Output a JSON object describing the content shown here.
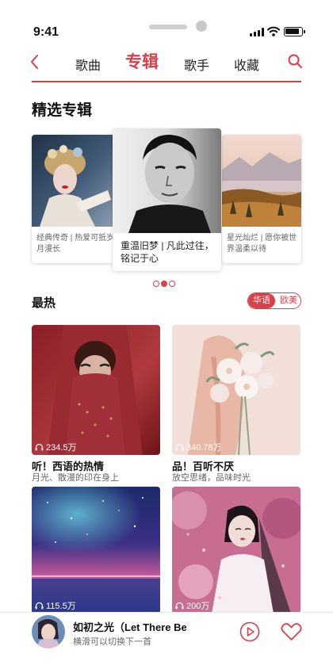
{
  "status": {
    "time": "9:41"
  },
  "nav": {
    "tabs": [
      "歌曲",
      "专辑",
      "歌手",
      "收藏"
    ],
    "active_tab": "专辑"
  },
  "featured": {
    "title": "精选专辑",
    "albums": [
      {
        "caption": "经典传奇 | 热爱可抵岁月漫长"
      },
      {
        "caption": "重温旧梦 | 凡此过往，铭记于心"
      },
      {
        "caption": "星光灿烂 | 愿你被世界温柔以待"
      }
    ],
    "page_count": 3,
    "active_page": 2
  },
  "hot": {
    "title": "最热",
    "languages": [
      "华语",
      "欧美"
    ],
    "active_language": "华语",
    "items": [
      {
        "plays": "234.5万",
        "title": "听！西语的热情",
        "subtitle": "月光、散漫的印在身上"
      },
      {
        "plays": "340.78万",
        "title": "品！百听不厌",
        "subtitle": "放空思绪，品味时光"
      },
      {
        "plays": "115.5万",
        "title": "",
        "subtitle": ""
      },
      {
        "plays": "200万",
        "title": "",
        "subtitle": ""
      }
    ]
  },
  "player": {
    "title": "如初之光（Let There Be",
    "subtitle": "横滑可以切换下一首"
  },
  "colors": {
    "accent": "#d8404a"
  }
}
